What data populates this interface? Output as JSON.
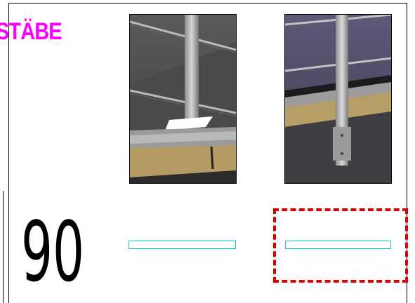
{
  "title": "STÄBE",
  "number_label": "90",
  "colors": {
    "title": "#ff00ff",
    "dimension_line": "#00d0d0",
    "selection": "#e00000"
  },
  "images": [
    {
      "icon": "railing-post-base-plate-image"
    },
    {
      "icon": "railing-post-side-mount-image"
    }
  ]
}
